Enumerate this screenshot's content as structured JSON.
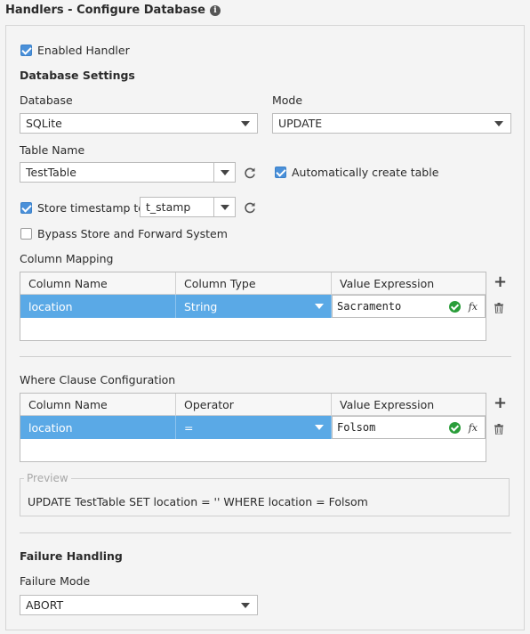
{
  "header": {
    "title": "Handlers - Configure Database",
    "info_icon": "info-icon"
  },
  "enabled_handler": {
    "label": "Enabled Handler",
    "checked": true
  },
  "database_settings": {
    "heading": "Database Settings",
    "database_label": "Database",
    "database_value": "SQLite",
    "mode_label": "Mode",
    "mode_value": "UPDATE",
    "table_name_label": "Table Name",
    "table_name_value": "TestTable",
    "auto_create_label": "Automatically create table",
    "auto_create_checked": true,
    "store_timestamp_label": "Store timestamp to",
    "store_timestamp_checked": true,
    "timestamp_column": "t_stamp",
    "bypass_label": "Bypass Store and Forward System",
    "bypass_checked": false
  },
  "column_mapping": {
    "label": "Column Mapping",
    "headers": [
      "Column Name",
      "Column Type",
      "Value Expression"
    ],
    "rows": [
      {
        "column": "location",
        "type": "String",
        "expression": "Sacramento"
      }
    ]
  },
  "where_clause": {
    "label": "Where Clause Configuration",
    "headers": [
      "Column Name",
      "Operator",
      "Value Expression"
    ],
    "rows": [
      {
        "column": "location",
        "operator": "=",
        "expression": "Folsom"
      }
    ]
  },
  "preview": {
    "legend": "Preview",
    "text": "UPDATE TestTable SET location = '' WHERE location = Folsom"
  },
  "failure_handling": {
    "heading": "Failure Handling",
    "mode_label": "Failure Mode",
    "mode_value": "ABORT"
  },
  "colors": {
    "accent": "#4a90d9",
    "selection": "#5aa9e6",
    "ok": "#2a9d3a"
  }
}
